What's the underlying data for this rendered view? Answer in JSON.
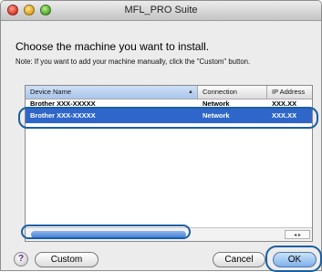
{
  "window": {
    "title": "MFL_PRO Suite"
  },
  "dialog": {
    "heading": "Choose the machine you want to install.",
    "note": "Note: If you want to add your machine manually, click the \"Custom\" button."
  },
  "table": {
    "columns": {
      "name": "Device Name",
      "connection": "Connection",
      "ip": "IP Address"
    },
    "rows": [
      {
        "name": "Brother XXX-XXXXX",
        "connection": "Network",
        "ip": "XXX.XX"
      },
      {
        "name": "Brother XXX-XXXXX",
        "connection": "Network",
        "ip": "XXX.XX"
      }
    ],
    "selected_row": 1,
    "scroll_arrows": "◂ ▸"
  },
  "buttons": {
    "help": "?",
    "custom": "Custom",
    "cancel": "Cancel",
    "ok": "OK"
  },
  "colors": {
    "selection": "#2f66c9",
    "highlight": "#1a5fa3"
  }
}
